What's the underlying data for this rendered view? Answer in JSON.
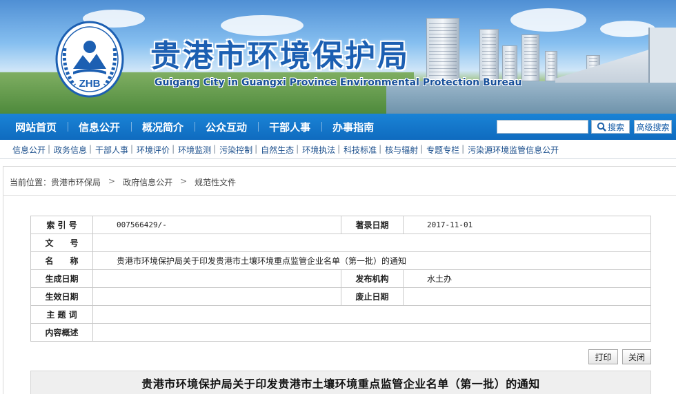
{
  "header": {
    "logo_text": "ZHB",
    "title_cn": "贵港市环境保护局",
    "title_en": "Guigang City in Guangxi Province Environmental Protection Bureau"
  },
  "main_nav": [
    "网站首页",
    "信息公开",
    "概况简介",
    "公众互动",
    "干部人事",
    "办事指南"
  ],
  "search": {
    "placeholder": "",
    "button_label": "搜索",
    "advanced_label": "高级搜索"
  },
  "sub_nav": [
    "信息公开",
    "政务信息",
    "干部人事",
    "环境评价",
    "环境监测",
    "污染控制",
    "自然生态",
    "环境执法",
    "科技标准",
    "核与辐射",
    "专题专栏",
    "污染源环境监管信息公开"
  ],
  "breadcrumb": {
    "prefix": "当前位置：",
    "items": [
      "贵港市环保局",
      "政府信息公开",
      "规范性文件"
    ],
    "separator": ">"
  },
  "info": {
    "index_label": "索 引 号",
    "index_value": "007566429/-",
    "date_recorded_label": "著录日期",
    "date_recorded_value": "2017-11-01",
    "doc_no_label": "文　　号",
    "doc_no_value": "",
    "name_label": "名　　称",
    "name_value": "贵港市环境保护局关于印发贵港市土壤环境重点监管企业名单（第一批）的通知",
    "created_label": "生成日期",
    "created_value": "",
    "publisher_label": "发布机构",
    "publisher_value": "水土办",
    "effective_label": "生效日期",
    "effective_value": "",
    "expired_label": "废止日期",
    "expired_value": "",
    "keywords_label": "主 题 词",
    "keywords_value": "",
    "summary_label": "内容概述",
    "summary_value": ""
  },
  "actions": {
    "print_label": "打印",
    "close_label": "关闭"
  },
  "document": {
    "title": "贵港市环境保护局关于印发贵港市土壤环境重点监管企业名单（第一批）的通知"
  },
  "colors": {
    "nav_blue": "#1277ca",
    "title_blue": "#1c5fb2",
    "link_blue": "#1b4f8c"
  }
}
